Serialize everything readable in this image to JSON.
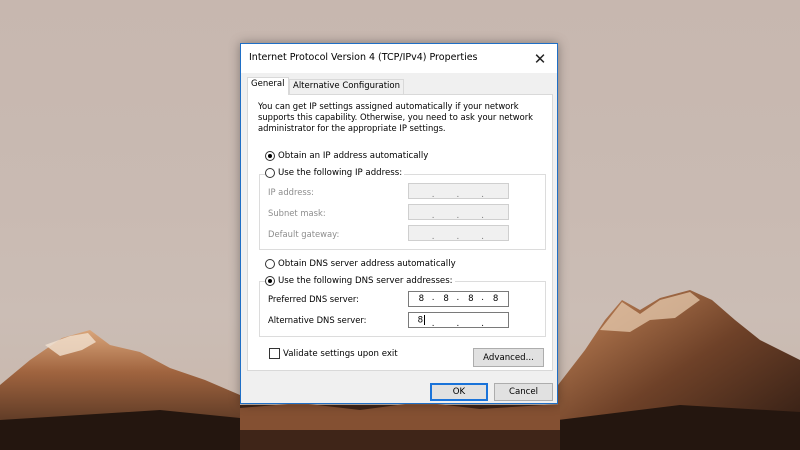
{
  "dialog": {
    "title": "Internet Protocol Version 4 (TCP/IPv4) Properties",
    "close_label": "✕"
  },
  "tabs": [
    {
      "label": "General",
      "active": true
    },
    {
      "label": "Alternative Configuration",
      "active": false
    }
  ],
  "general": {
    "description": "You can get IP settings assigned automatically if your network supports this capability. Otherwise, you need to ask your network administrator for the appropriate IP settings.",
    "ip_auto_label": "Obtain an IP address automatically",
    "ip_manual_label": "Use the following IP address:",
    "ip_mode": "auto",
    "ip_fields": [
      {
        "label": "IP address:",
        "octets": [
          "",
          "",
          "",
          ""
        ]
      },
      {
        "label": "Subnet mask:",
        "octets": [
          "",
          "",
          "",
          ""
        ]
      },
      {
        "label": "Default gateway:",
        "octets": [
          "",
          "",
          "",
          ""
        ]
      }
    ],
    "dns_auto_label": "Obtain DNS server address automatically",
    "dns_manual_label": "Use the following DNS server addresses:",
    "dns_mode": "manual",
    "dns_fields": [
      {
        "label": "Preferred DNS server:",
        "octets": [
          "8",
          "8",
          "8",
          "8"
        ]
      },
      {
        "label": "Alternative DNS server:",
        "octets": [
          "8",
          "",
          "",
          ""
        ]
      }
    ],
    "validate_label": "Validate settings upon exit",
    "validate_checked": false,
    "advanced_label": "Advanced..."
  },
  "footer": {
    "ok_label": "OK",
    "cancel_label": "Cancel"
  },
  "colors": {
    "title_accent": "#1f6fc6",
    "default_button": "#1a73d9"
  }
}
